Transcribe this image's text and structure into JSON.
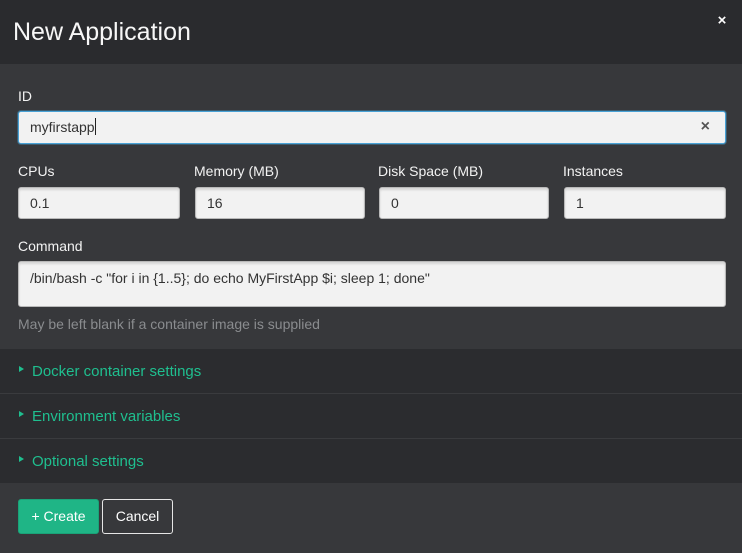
{
  "dialog": {
    "title": "New Application",
    "close_label": "×"
  },
  "form": {
    "id": {
      "label": "ID",
      "value": "myfirstapp",
      "clear_label": "×"
    },
    "cpus": {
      "label": "CPUs",
      "value": "0.1"
    },
    "memory": {
      "label": "Memory (MB)",
      "value": "16"
    },
    "disk": {
      "label": "Disk Space (MB)",
      "value": "0"
    },
    "instances": {
      "label": "Instances",
      "value": "1"
    },
    "command": {
      "label": "Command",
      "value": "/bin/bash -c \"for i in {1..5}; do echo MyFirstApp $i; sleep 1; done\"",
      "help": "May be left blank if a container image is supplied"
    }
  },
  "sections": [
    {
      "label": "Docker container settings",
      "icon": "triangle-right-icon"
    },
    {
      "label": "Environment variables",
      "icon": "triangle-right-icon"
    },
    {
      "label": "Optional settings",
      "icon": "triangle-right-icon"
    }
  ],
  "footer": {
    "create_label": "+ Create",
    "cancel_label": "Cancel"
  },
  "colors": {
    "accent": "#1fbf8f",
    "background": "#303134",
    "focus_border": "#49a2d6"
  }
}
